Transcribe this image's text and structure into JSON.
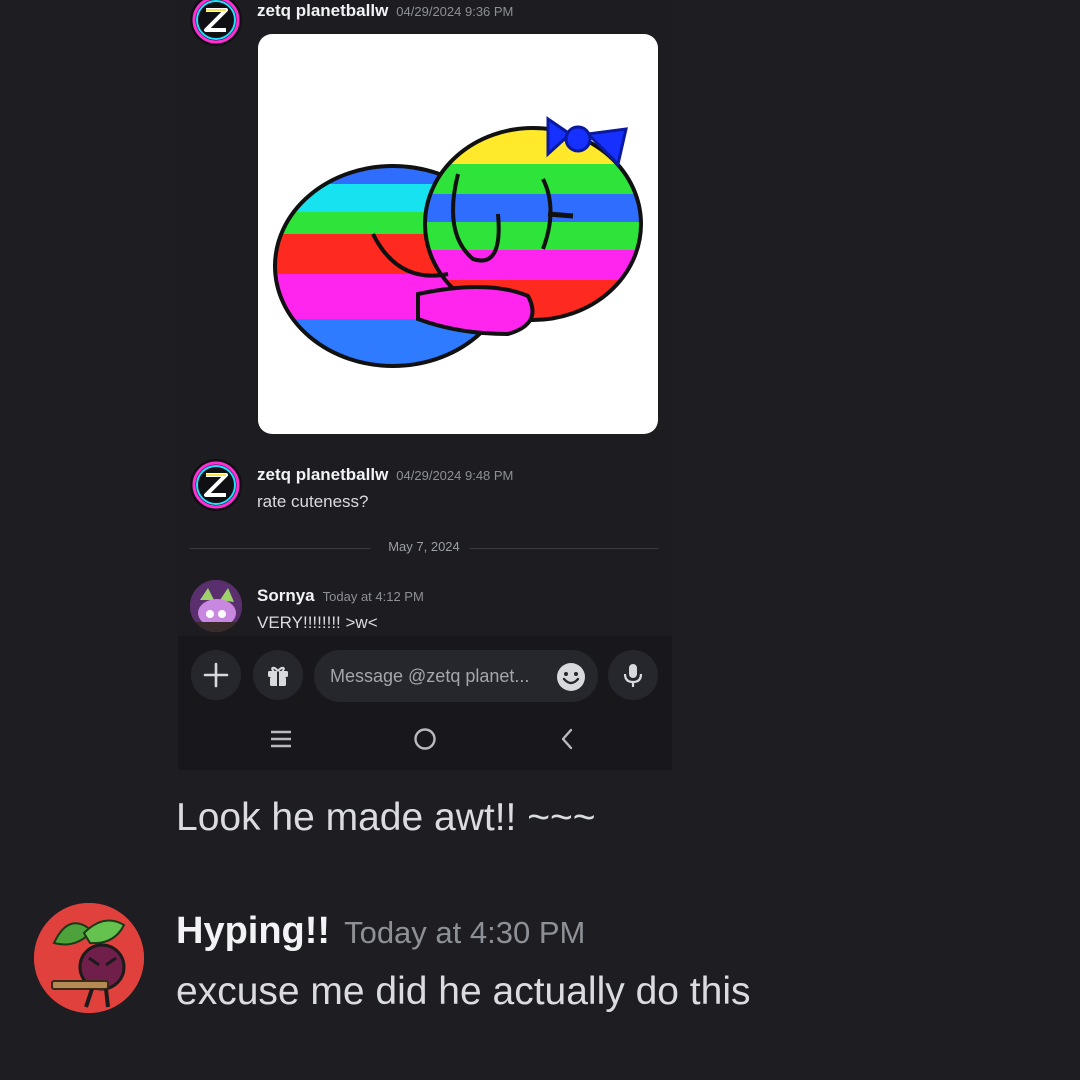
{
  "screenshot": {
    "messages": [
      {
        "author": "zetq planetballw",
        "timestamp": "04/29/2024 9:36 PM"
      },
      {
        "author": "zetq planetballw",
        "timestamp": "04/29/2024 9:48 PM",
        "text": "rate cuteness?"
      },
      {
        "author": "Sornya",
        "timestamp": "Today at 4:12 PM",
        "text": "VERY!!!!!!!! >w<"
      }
    ],
    "date_divider": "May 7, 2024",
    "composer": {
      "placeholder": "Message @zetq planet..."
    },
    "icons": {
      "add": "plus-icon",
      "gift": "gift-icon",
      "emoji": "emoji-icon",
      "mic": "microphone-icon",
      "nav_menu": "menu-icon",
      "nav_home": "home-circle-icon",
      "nav_back": "back-chevron-icon"
    }
  },
  "outer_chat": {
    "continued_text": "Look he made awt!! ~~~",
    "message": {
      "author": "Hyping!!",
      "timestamp": "Today at 4:30 PM",
      "text": "excuse me did he actually do this"
    }
  },
  "colors": {
    "background": "#1d1d22",
    "author_name": "#f2f3f5",
    "timestamp": "#8e9097",
    "avatar_red": "#e0413d"
  }
}
